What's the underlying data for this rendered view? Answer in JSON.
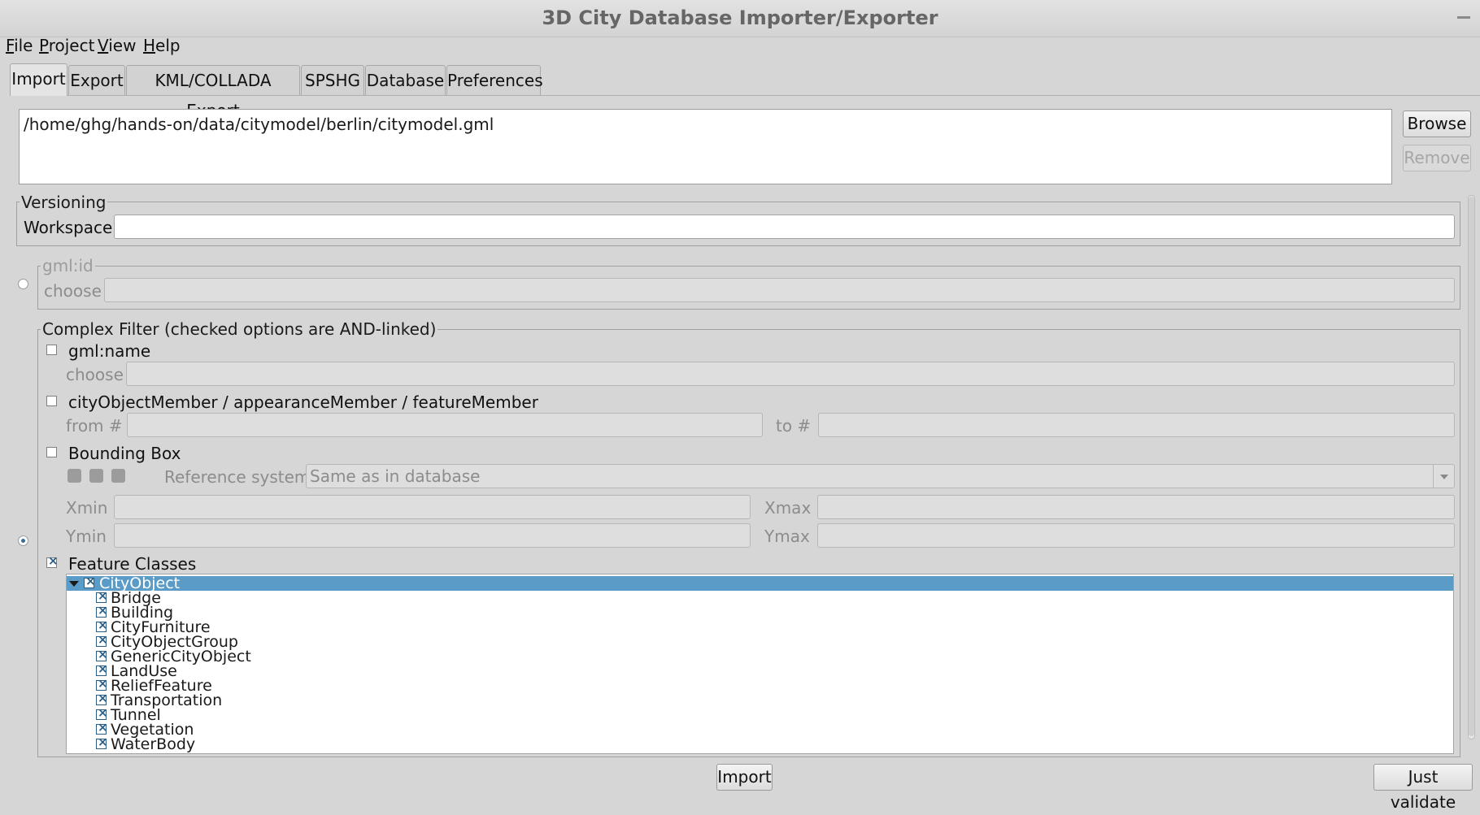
{
  "window": {
    "title": "3D City Database Importer/Exporter"
  },
  "menu": [
    {
      "label": "File",
      "accel": "F",
      "rest": "ile"
    },
    {
      "label": "Project",
      "accel": "P",
      "rest": "roject"
    },
    {
      "label": "View",
      "accel": "V",
      "rest": "iew"
    },
    {
      "label": "Help",
      "accel": "H",
      "rest": "elp"
    }
  ],
  "tabs": [
    "Import",
    "Export",
    "KML/COLLADA Export",
    "SPSHG",
    "Database",
    "Preferences"
  ],
  "active_tab": "Import",
  "files": {
    "path": "/home/ghg/hands-on/data/citymodel/berlin/citymodel.gml"
  },
  "buttons": {
    "browse": "Browse",
    "remove": "Remove",
    "import": "Import",
    "validate": "Just validate"
  },
  "versioning": {
    "legend": "Versioning",
    "workspace_label": "Workspace",
    "workspace_value": ""
  },
  "gmlid": {
    "legend": "gml:id",
    "choose_label": "choose",
    "value": ""
  },
  "complex": {
    "legend": "Complex Filter (checked options are AND-linked)",
    "name": {
      "label": "gml:name",
      "choose_label": "choose"
    },
    "member": {
      "label": "cityObjectMember / appearanceMember / featureMember",
      "from_label": "from #",
      "to_label": "to #"
    },
    "bbox": {
      "label": "Bounding Box",
      "ref_label": "Reference system",
      "ref_value": "Same as in database",
      "xmin": "Xmin",
      "xmax": "Xmax",
      "ymin": "Ymin",
      "ymax": "Ymax"
    },
    "feature_classes": {
      "label": "Feature Classes",
      "root": "CityObject",
      "children": [
        "Bridge",
        "Building",
        "CityFurniture",
        "CityObjectGroup",
        "GenericCityObject",
        "LandUse",
        "ReliefFeature",
        "Transportation",
        "Tunnel",
        "Vegetation",
        "WaterBody"
      ]
    }
  },
  "colors": {
    "selection": "#5a9bc7",
    "window_bg": "#d6d6d6"
  }
}
